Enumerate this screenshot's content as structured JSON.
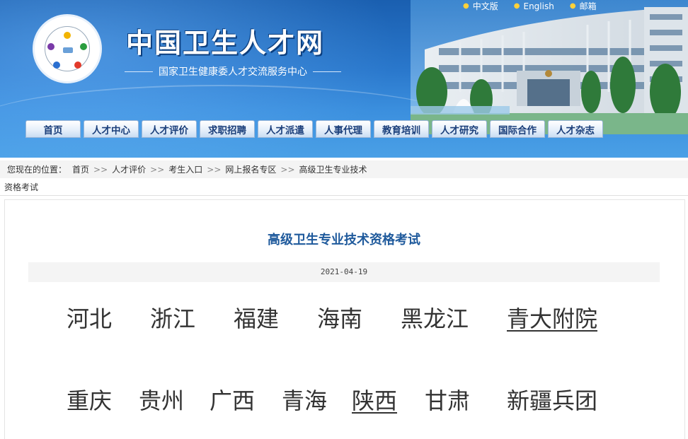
{
  "top_links": [
    {
      "label": "中文版"
    },
    {
      "label": "English"
    },
    {
      "label": "邮箱"
    }
  ],
  "site": {
    "title": "中国卫生人才网",
    "subtitle": "国家卫生健康委人才交流服务中心"
  },
  "nav": [
    {
      "label": "首页"
    },
    {
      "label": "人才中心"
    },
    {
      "label": "人才评价"
    },
    {
      "label": "求职招聘"
    },
    {
      "label": "人才派遣"
    },
    {
      "label": "人事代理"
    },
    {
      "label": "教育培训"
    },
    {
      "label": "人才研究"
    },
    {
      "label": "国际合作"
    },
    {
      "label": "人才杂志"
    }
  ],
  "breadcrumb": {
    "prefix": "您现在的位置：",
    "items": [
      "首页",
      "人才评价",
      "考生入口",
      "网上报名专区",
      "高级卫生专业技术"
    ],
    "continuation": "资格考试",
    "separator": ">>"
  },
  "article": {
    "title": "高级卫生专业技术资格考试",
    "date": "2021-04-19"
  },
  "regions_row1": [
    "河北",
    "浙江",
    "福建",
    "海南",
    "黑龙江",
    "青大附院"
  ],
  "regions_row2": [
    "重庆",
    "贵州",
    "广西",
    "青海",
    "陕西",
    "甘肃",
    "新疆兵团"
  ],
  "colors": {
    "header_blue": "#1a5fb0",
    "nav_text": "#1a3e7a",
    "title_blue": "#1f5a9c",
    "dot_yellow": "#ffd13a"
  }
}
